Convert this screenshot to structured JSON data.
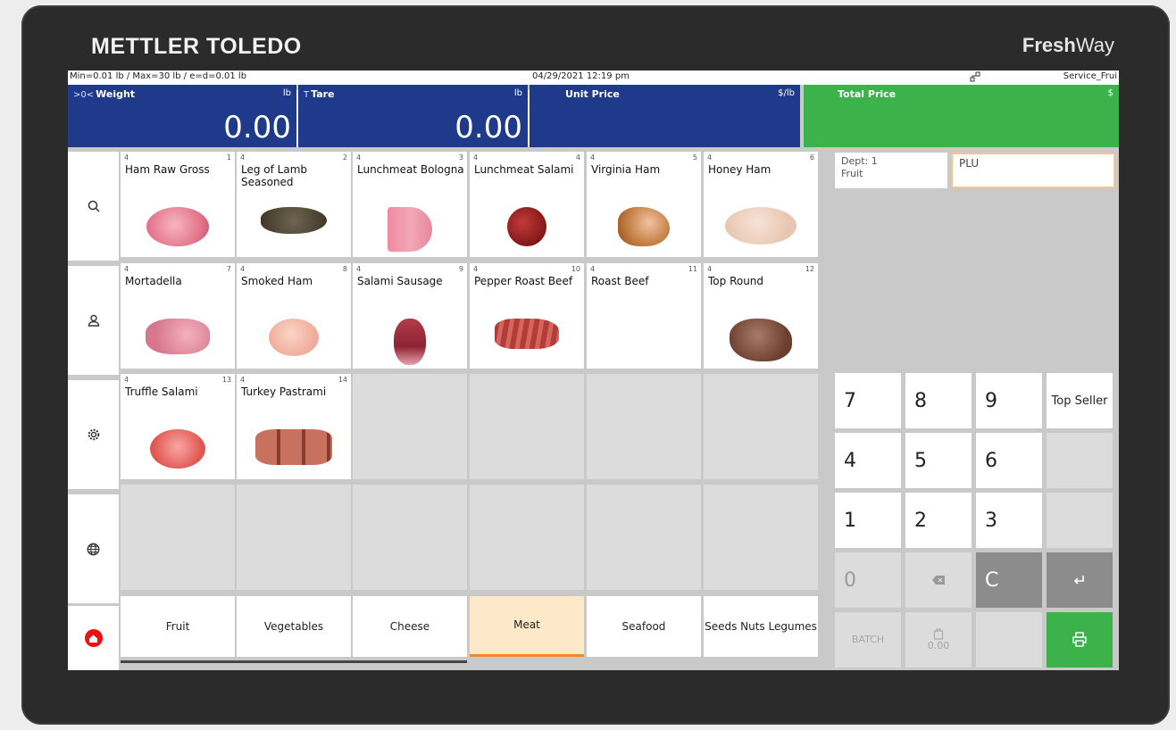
{
  "device": {
    "brand_left": "METTLER TOLEDO",
    "brand_right_bold": "Fresh",
    "brand_right_thin": "Way"
  },
  "status": {
    "limits": "Min=0.01 lb / Max=30 lb / e=d=0.01 lb",
    "datetime": "04/29/2021 12:19 pm",
    "network_icon": "network-icon",
    "user": "Service_Frui"
  },
  "displays": {
    "weight": {
      "prefix": ">0<",
      "label": "Weight",
      "unit": "lb",
      "value": "0.00"
    },
    "tare": {
      "prefix": "T",
      "label": "Tare",
      "unit": "lb",
      "value": "0.00"
    },
    "unit_price": {
      "label": "Unit Price",
      "unit": "$/lb",
      "value": ""
    },
    "total_price": {
      "label": "Total Price",
      "unit": "$",
      "value": ""
    }
  },
  "sidebar": [
    "search-icon",
    "user-icon",
    "settings-icon",
    "globe-icon",
    "home-icon"
  ],
  "products": [
    {
      "dept": "4",
      "num": "1",
      "name": "Ham Raw Gross",
      "img": "ham"
    },
    {
      "dept": "4",
      "num": "2",
      "name": "Leg of Lamb Seasoned",
      "img": "lamb"
    },
    {
      "dept": "4",
      "num": "3",
      "name": "Lunchmeat Bologna",
      "img": "bologna"
    },
    {
      "dept": "4",
      "num": "4",
      "name": "Lunchmeat Salami",
      "img": "salami"
    },
    {
      "dept": "4",
      "num": "5",
      "name": "Virginia Ham",
      "img": "vham"
    },
    {
      "dept": "4",
      "num": "6",
      "name": "Honey Ham",
      "img": "honey"
    },
    {
      "dept": "4",
      "num": "7",
      "name": "Mortadella",
      "img": "morta"
    },
    {
      "dept": "4",
      "num": "8",
      "name": "Smoked Ham",
      "img": "smoked"
    },
    {
      "dept": "4",
      "num": "9",
      "name": "Salami Sausage",
      "img": "sausage"
    },
    {
      "dept": "4",
      "num": "10",
      "name": "Pepper Roast Beef",
      "img": "beef"
    },
    {
      "dept": "4",
      "num": "11",
      "name": "Roast Beef",
      "img": ""
    },
    {
      "dept": "4",
      "num": "12",
      "name": "Top Round",
      "img": "topround"
    },
    {
      "dept": "4",
      "num": "13",
      "name": "Truffle Salami",
      "img": "truffle"
    },
    {
      "dept": "4",
      "num": "14",
      "name": "Turkey Pastrami",
      "img": "pastrami"
    }
  ],
  "categories": [
    {
      "label": "Fruit",
      "active": false
    },
    {
      "label": "Vegetables",
      "active": false
    },
    {
      "label": "Cheese",
      "active": false
    },
    {
      "label": "Meat",
      "active": true
    },
    {
      "label": "Seafood",
      "active": false
    },
    {
      "label": "Seeds Nuts Legumes",
      "active": false
    }
  ],
  "dept_box": {
    "line1": "Dept: 1",
    "line2": "Fruit"
  },
  "plu": {
    "label": "PLU"
  },
  "keypad": {
    "k7": "7",
    "k8": "8",
    "k9": "9",
    "top_seller": "Top Seller",
    "k4": "4",
    "k5": "5",
    "k6": "6",
    "k1": "1",
    "k2": "2",
    "k3": "3",
    "k0": "0",
    "clear": "C",
    "batch": "BATCH",
    "bag_value": "0.00"
  },
  "colors": {
    "display_blue": "#1f3a8a",
    "display_green": "#3bb34a",
    "accent_orange": "#f08a24"
  }
}
